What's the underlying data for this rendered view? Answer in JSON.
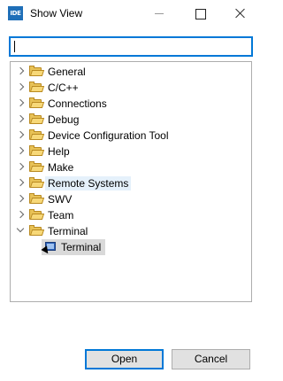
{
  "window": {
    "app_icon_text": "IDE",
    "title": "Show View"
  },
  "filter": {
    "value": "",
    "placeholder": ""
  },
  "tree": {
    "categories": [
      {
        "label": "General",
        "expanded": false
      },
      {
        "label": "C/C++",
        "expanded": false
      },
      {
        "label": "Connections",
        "expanded": false
      },
      {
        "label": "Debug",
        "expanded": false
      },
      {
        "label": "Device Configuration Tool",
        "expanded": false
      },
      {
        "label": "Help",
        "expanded": false
      },
      {
        "label": "Make",
        "expanded": false
      },
      {
        "label": "Remote Systems",
        "expanded": false,
        "hovered": true
      },
      {
        "label": "SWV",
        "expanded": false
      },
      {
        "label": "Team",
        "expanded": false
      },
      {
        "label": "Terminal",
        "expanded": true
      }
    ],
    "selected_view": {
      "label": "Terminal",
      "icon": "terminal-icon"
    }
  },
  "buttons": {
    "open": "Open",
    "cancel": "Cancel"
  },
  "colors": {
    "focus_blue": "#0078d7",
    "hover_bg": "#e5f1fb",
    "selection_bg": "#d9d9d9",
    "folder_yellow": "#e8c257"
  }
}
